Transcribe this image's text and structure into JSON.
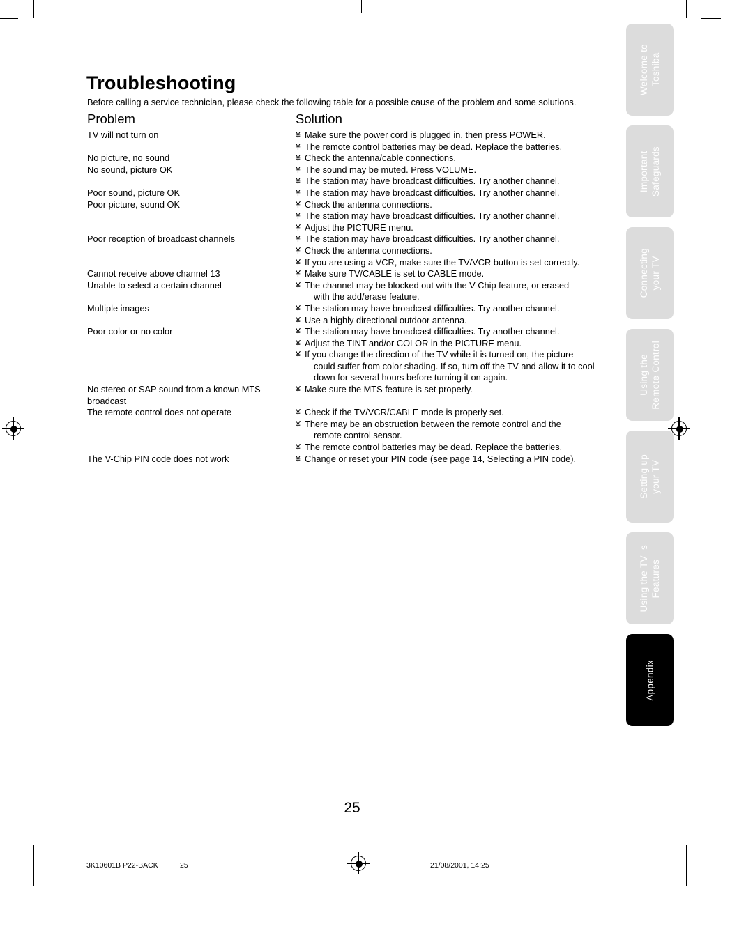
{
  "document": {
    "title": "Troubleshooting",
    "intro": "Before calling a service technician, please check the following table for a possible cause of the problem and some solutions.",
    "columns": {
      "problem": "Problem",
      "solution": "Solution"
    },
    "bullet": "¥",
    "page_number": "25"
  },
  "rows": [
    {
      "problem": "TV will not turn on",
      "solutions": [
        {
          "text": "Make sure the power cord is plugged in, then press POWER.",
          "cont": ""
        },
        {
          "text": "The remote control batteries may be dead. Replace the batteries.",
          "cont": ""
        }
      ]
    },
    {
      "problem": "No picture, no sound",
      "solutions": [
        {
          "text": "Check the antenna/cable connections.",
          "cont": ""
        }
      ]
    },
    {
      "problem": "No sound, picture OK",
      "solutions": [
        {
          "text": "The sound may be muted. Press VOLUME.",
          "cont": ""
        },
        {
          "text": "The station may have broadcast difficulties. Try another channel.",
          "cont": ""
        }
      ]
    },
    {
      "problem": "Poor sound, picture OK",
      "solutions": [
        {
          "text": "The station may have broadcast difficulties. Try another channel.",
          "cont": ""
        }
      ]
    },
    {
      "problem": "Poor picture, sound OK",
      "solutions": [
        {
          "text": "Check the antenna connections.",
          "cont": ""
        },
        {
          "text": "The station may have broadcast difficulties. Try another channel.",
          "cont": ""
        },
        {
          "text": "Adjust the PICTURE menu.",
          "cont": ""
        }
      ]
    },
    {
      "problem": "Poor reception of broadcast channels",
      "solutions": [
        {
          "text": "The station may have broadcast difficulties. Try another channel.",
          "cont": ""
        },
        {
          "text": "Check the antenna connections.",
          "cont": ""
        },
        {
          "text": "If you are using a VCR, make sure the TV/VCR button is set correctly.",
          "cont": ""
        }
      ]
    },
    {
      "problem": "Cannot receive above channel 13",
      "solutions": [
        {
          "text": "Make sure TV/CABLE is set to CABLE mode.",
          "cont": ""
        }
      ]
    },
    {
      "problem": "Unable to select a certain channel",
      "solutions": [
        {
          "text": "The channel may be blocked out with the V-Chip feature, or erased",
          "cont": "with the add/erase feature."
        }
      ]
    },
    {
      "problem": "Multiple images",
      "solutions": [
        {
          "text": "The station may have broadcast difficulties. Try another channel.",
          "cont": ""
        },
        {
          "text": "Use a highly directional outdoor antenna.",
          "cont": ""
        }
      ]
    },
    {
      "problem": "Poor color or no color",
      "solutions": [
        {
          "text": "The station may have broadcast difficulties. Try another channel.",
          "cont": ""
        },
        {
          "text": "Adjust the TINT and/or COLOR in the PICTURE menu.",
          "cont": ""
        },
        {
          "text": "If you change the direction of the TV while it is turned on, the picture",
          "cont": "could suffer from color shading. If so, turn off the TV and allow it to cool down for several hours before turning it on again."
        }
      ]
    },
    {
      "problem": "No stereo or SAP sound from a known MTS broadcast",
      "solutions": [
        {
          "text": "Make sure the MTS feature is set properly.",
          "cont": ""
        }
      ]
    },
    {
      "problem": "The remote control does not operate",
      "solutions": [
        {
          "text": "Check if the TV/VCR/CABLE mode is properly set.",
          "cont": ""
        },
        {
          "text": "There may be an obstruction between the remote control and the",
          "cont": "remote control sensor."
        },
        {
          "text": "The remote control batteries may be dead. Replace the batteries.",
          "cont": ""
        }
      ]
    },
    {
      "problem": "The V-Chip PIN code does not work",
      "solutions": [
        {
          "text": "Change or reset your PIN code (see page 14, Selecting a PIN code).",
          "cont": ""
        }
      ]
    }
  ],
  "tabs": [
    {
      "label": "Welcome to\nToshiba",
      "active": false
    },
    {
      "label": "Important\nSafeguards",
      "active": false
    },
    {
      "label": "Connecting\nyour TV",
      "active": false
    },
    {
      "label": "Using the\nRemote Control",
      "active": false
    },
    {
      "label": "Setting up\nyour TV",
      "active": false
    },
    {
      "label": "Using the TV  s\nFeatures",
      "active": false
    },
    {
      "label": "Appendix",
      "active": true
    }
  ],
  "footer": {
    "job": "3K10601B P22-BACK",
    "page": "25",
    "date": "21/08/2001, 14:25"
  },
  "colors": {
    "tab_inactive": "#dcdcdc",
    "tab_active": "#000000",
    "tab_text": "#ffffff",
    "text": "#000000",
    "background": "#ffffff"
  }
}
